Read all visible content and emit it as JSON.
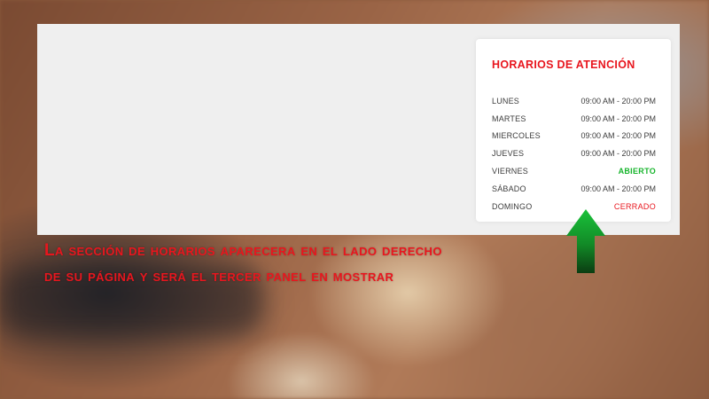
{
  "hours_panel": {
    "title": "HORARIOS DE ATENCIÓN",
    "rows": [
      {
        "day": "LUNES",
        "hours": "09:00 AM - 20:00 PM",
        "status": "normal"
      },
      {
        "day": "MARTES",
        "hours": "09:00 AM - 20:00 PM",
        "status": "normal"
      },
      {
        "day": "MIERCOLES",
        "hours": "09:00 AM - 20:00 PM",
        "status": "normal"
      },
      {
        "day": "JUEVES",
        "hours": "09:00 AM - 20:00 PM",
        "status": "normal"
      },
      {
        "day": "VIERNES",
        "hours": "ABIERTO",
        "status": "open"
      },
      {
        "day": "SÁBADO",
        "hours": "09:00 AM - 20:00 PM",
        "status": "normal"
      },
      {
        "day": "DOMINGO",
        "hours": "CERRADO",
        "status": "closed"
      }
    ]
  },
  "caption": {
    "line1": "La sección de horarios aparecera en el lado derecho",
    "line2": "de su página y será el tercer panel en mostrar"
  },
  "colors": {
    "accent_red": "#e8161e",
    "open_green": "#17b52c",
    "arrow_green_top": "#19c23a",
    "arrow_green_bottom": "#0b3d12"
  },
  "icons": {
    "arrow": "arrow-up-icon"
  }
}
